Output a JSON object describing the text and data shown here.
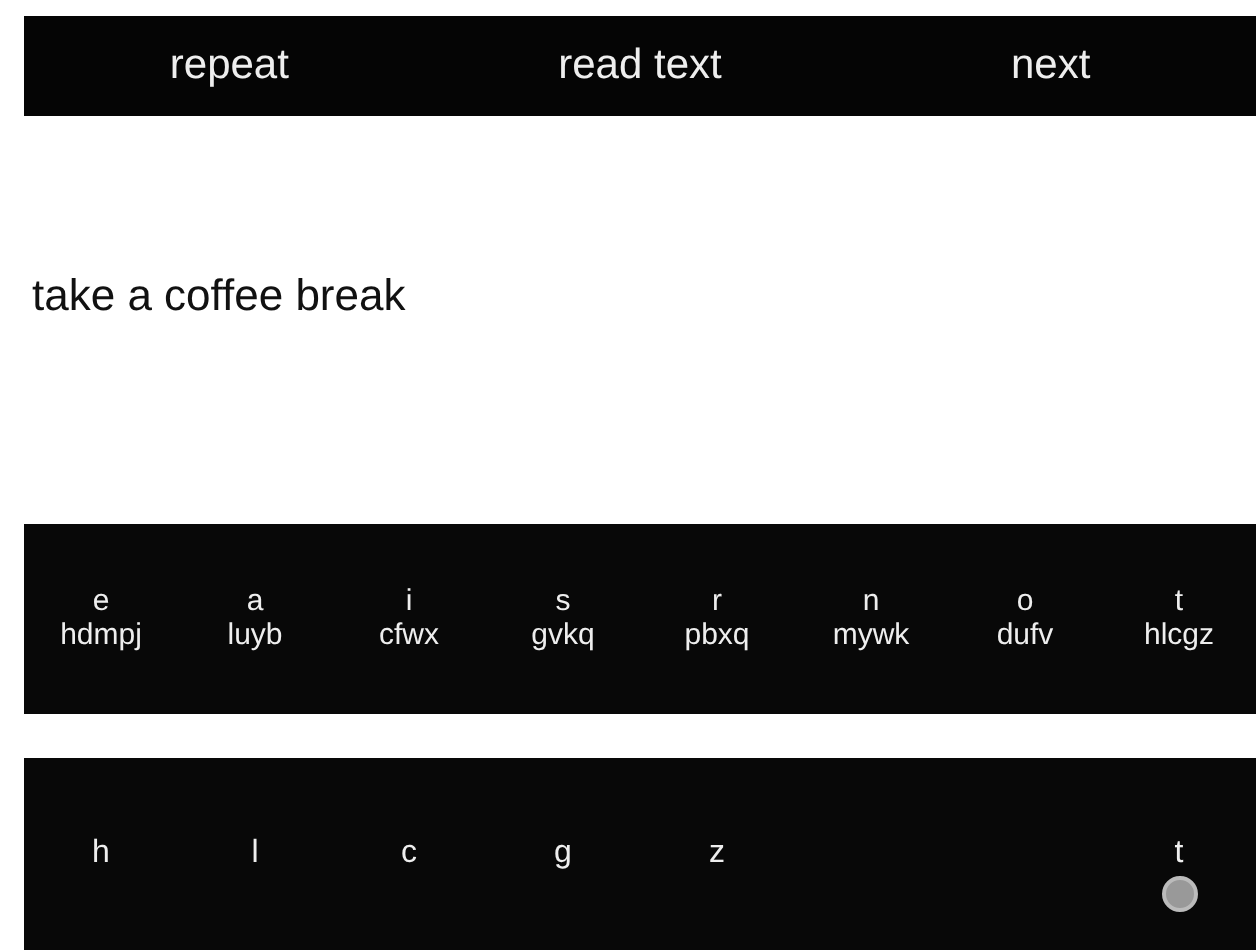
{
  "toolbar": {
    "buttons": [
      "repeat",
      "read text",
      "next"
    ]
  },
  "phrase": "take a coffee break",
  "key_groups": [
    {
      "letter": "e",
      "group": "hdmpj"
    },
    {
      "letter": "a",
      "group": "luyb"
    },
    {
      "letter": "i",
      "group": "cfwx"
    },
    {
      "letter": "s",
      "group": "gvkq"
    },
    {
      "letter": "r",
      "group": "pbxq"
    },
    {
      "letter": "n",
      "group": "mywk"
    },
    {
      "letter": "o",
      "group": "dufv"
    },
    {
      "letter": "t",
      "group": "hlcgz"
    }
  ],
  "keys": [
    {
      "letter": "h",
      "touched": false
    },
    {
      "letter": "l",
      "touched": false
    },
    {
      "letter": "c",
      "touched": false
    },
    {
      "letter": "g",
      "touched": false
    },
    {
      "letter": "z",
      "touched": false
    },
    {
      "touched": false
    },
    {
      "touched": false
    },
    {
      "letter": "t",
      "touched": true
    }
  ]
}
